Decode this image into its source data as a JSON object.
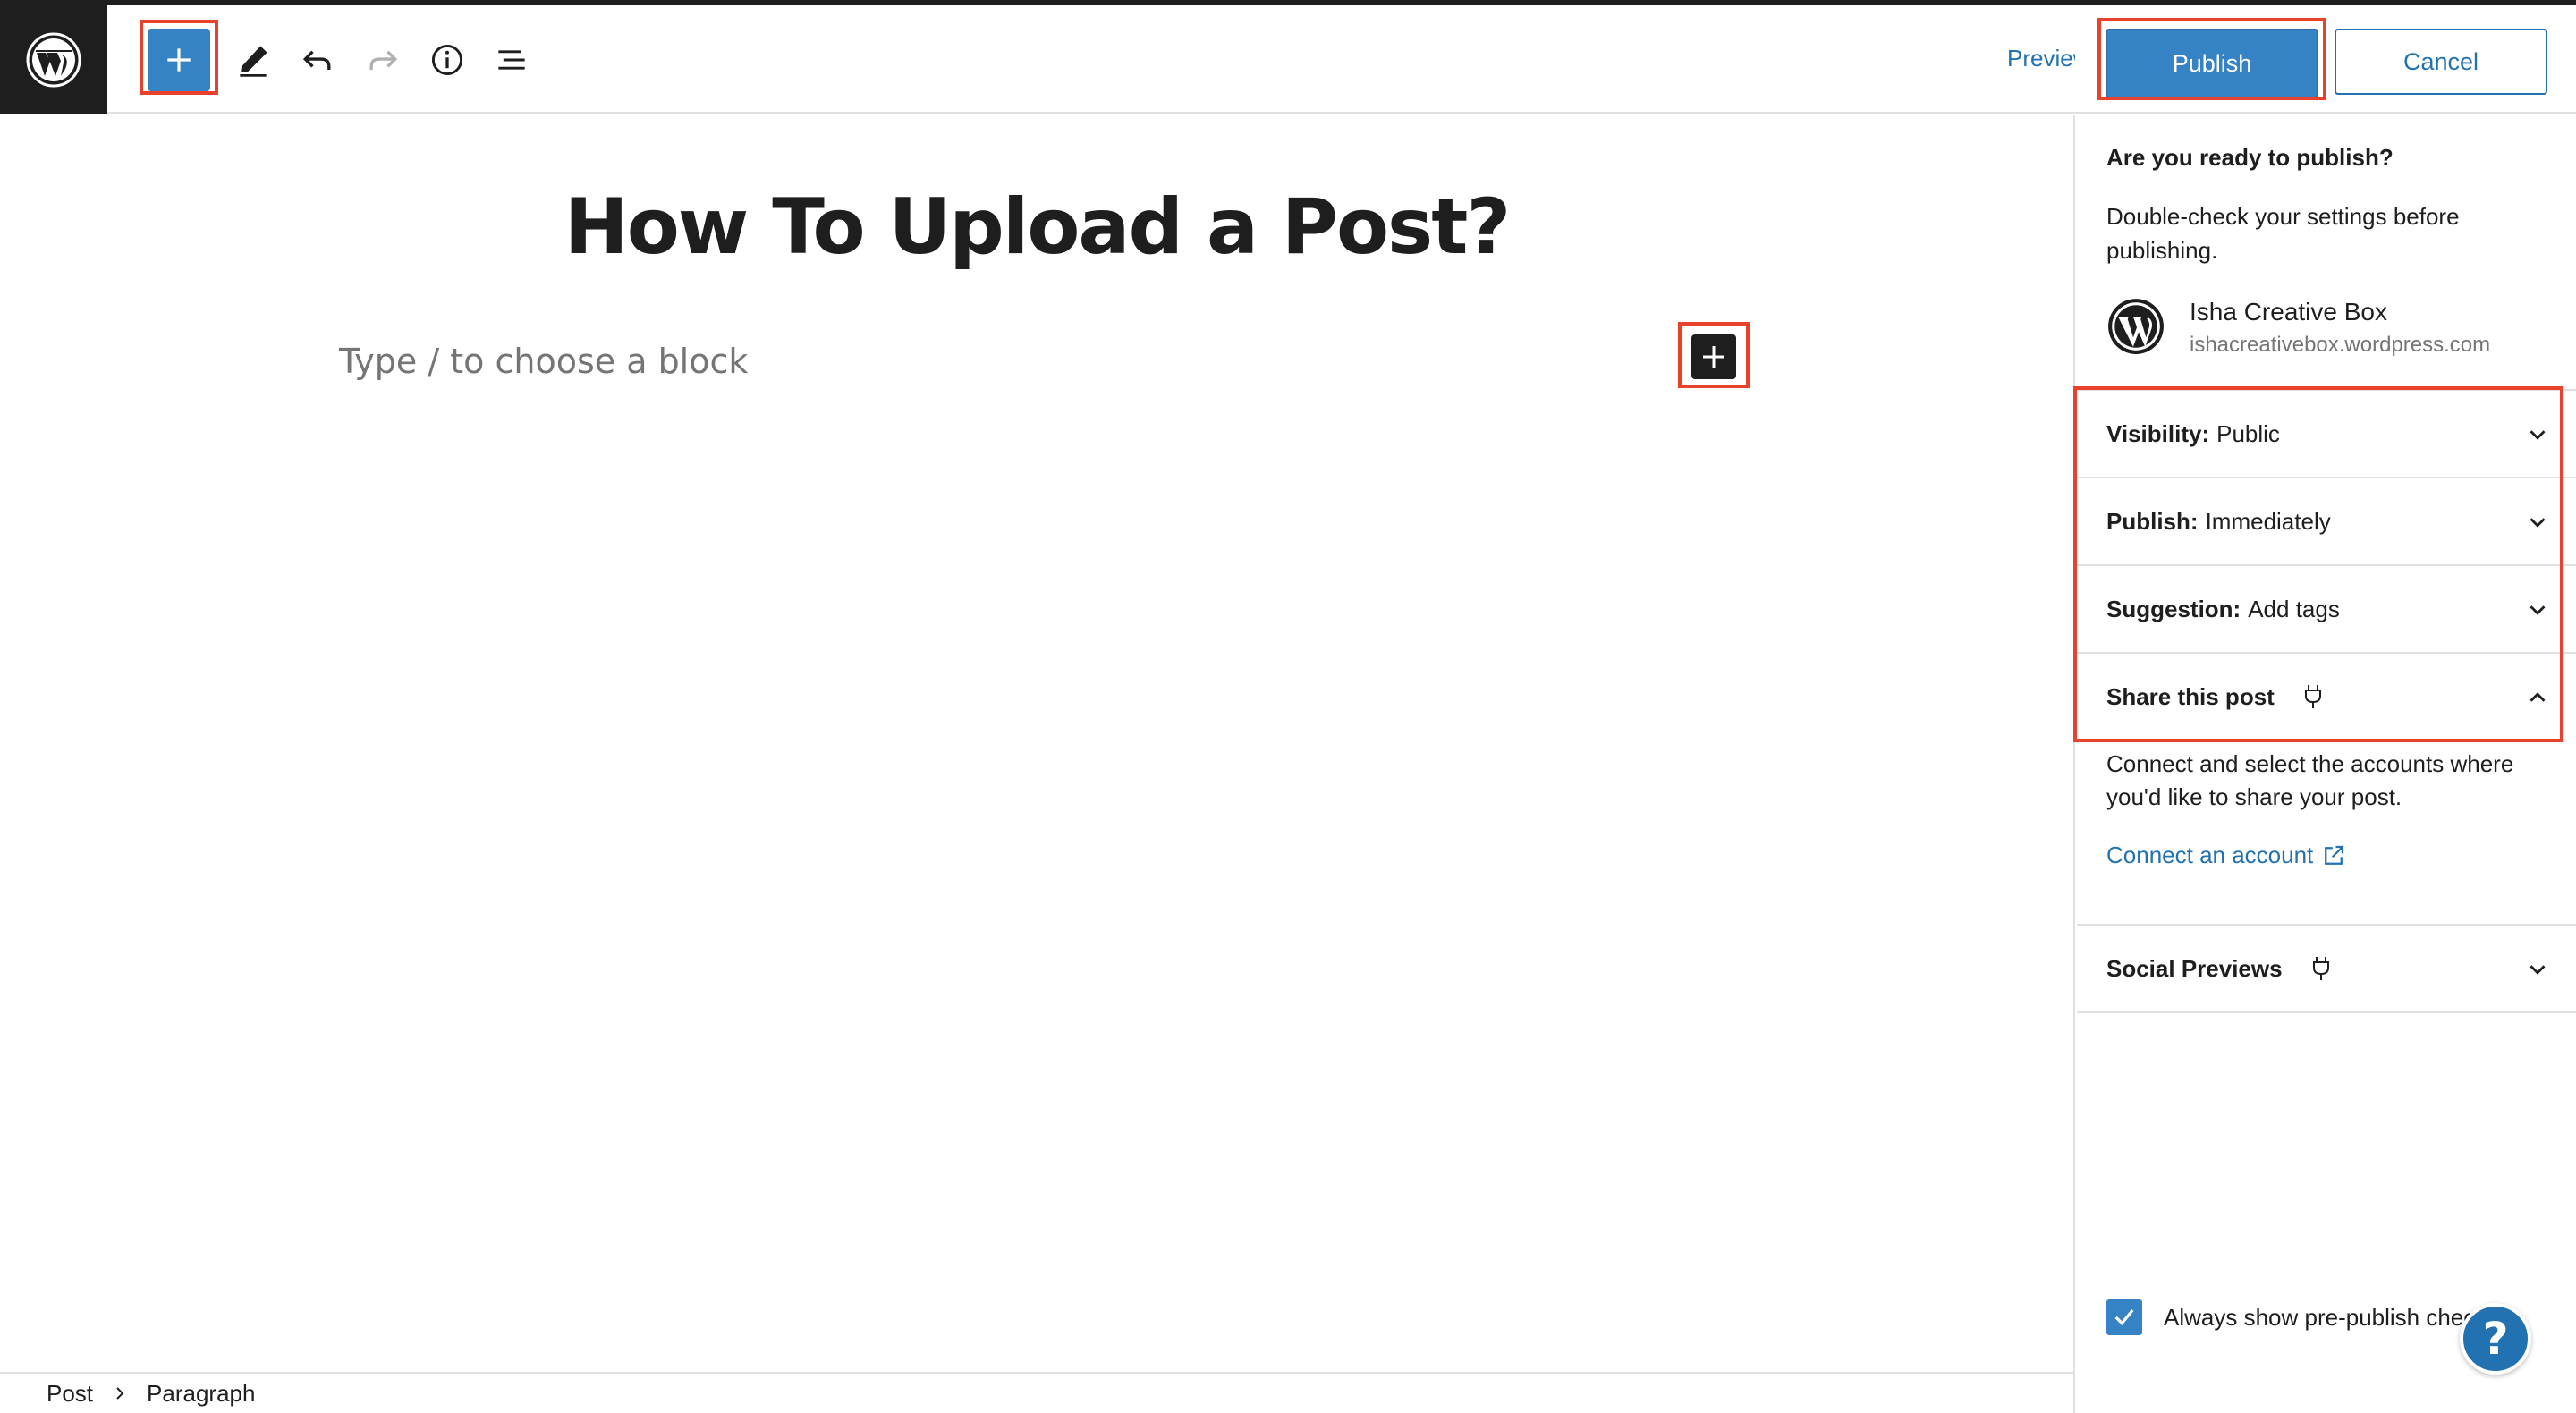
{
  "toolbar": {
    "preview_label": "Preview",
    "publish_label": "Publish",
    "cancel_label": "Cancel",
    "icons": [
      "wordpress-logo",
      "plus-icon",
      "pencil-icon",
      "undo-icon",
      "redo-icon",
      "info-icon",
      "list-view-icon"
    ]
  },
  "editor": {
    "title": "How To Upload a Post?",
    "block_placeholder": "Type / to choose a block"
  },
  "breadcrumb": {
    "items": [
      "Post",
      "Paragraph"
    ]
  },
  "sidebar": {
    "ready_question": "Are you ready to publish?",
    "ready_description": "Double-check your settings before publishing.",
    "site_name": "Isha Creative Box",
    "site_url": "ishacreativebox.wordpress.com",
    "panels": [
      {
        "label": "Visibility:",
        "value": "Public",
        "state": "collapsed"
      },
      {
        "label": "Publish:",
        "value": "Immediately",
        "state": "collapsed"
      },
      {
        "label": "Suggestion:",
        "value": "Add tags",
        "state": "collapsed"
      },
      {
        "label": "Share this post",
        "value": "",
        "state": "expanded"
      },
      {
        "label": "Social Previews",
        "value": "",
        "state": "collapsed"
      }
    ],
    "share_description": "Connect and select the accounts where you'd like to share your post.",
    "connect_link": "Connect an account",
    "always_show_label": "Always show pre-publish checks",
    "always_show_checked": true,
    "help_label": "?"
  },
  "colors": {
    "accent": "#3582c4",
    "link": "#2271b1",
    "dark": "#1e1e1e",
    "highlight": "#e8412c"
  }
}
